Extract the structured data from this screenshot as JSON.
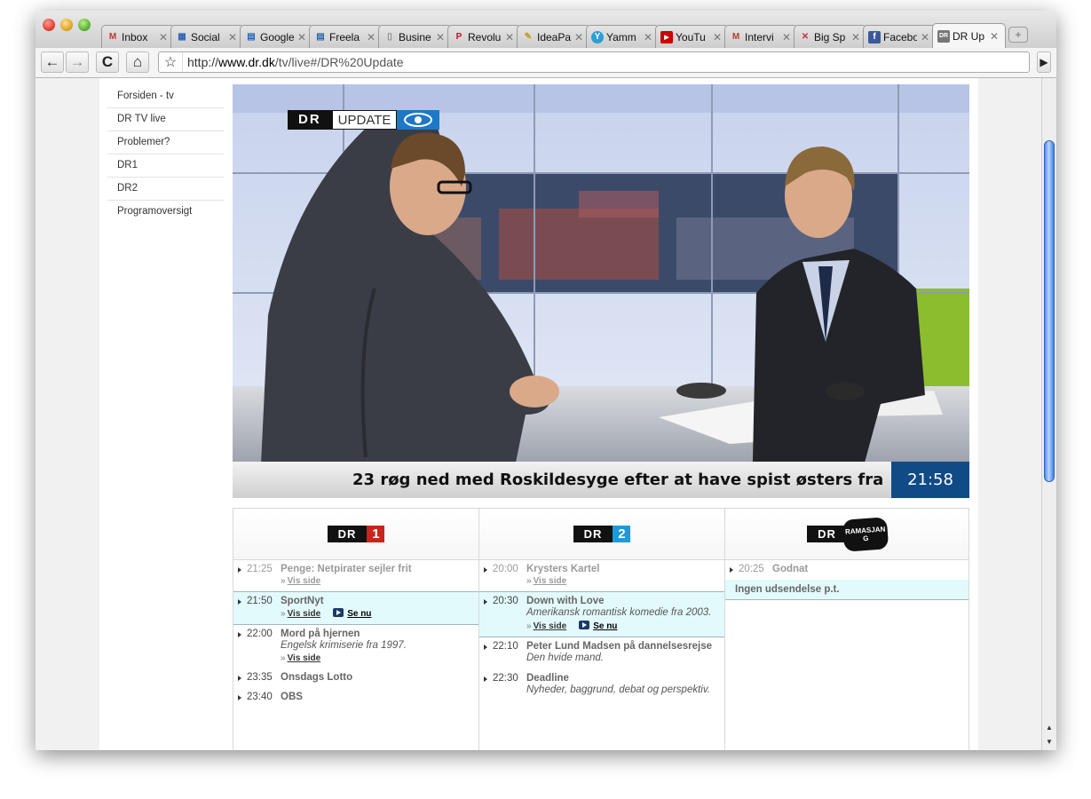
{
  "browser": {
    "tabs": [
      {
        "label": "Inbox",
        "icon": "gmail-icon",
        "glyph": "M",
        "color": "#c0392b"
      },
      {
        "label": "Social",
        "icon": "calendar-icon",
        "glyph": "▦",
        "color": "#2a64b4"
      },
      {
        "label": "Google",
        "icon": "google-docs-icon",
        "glyph": "▤",
        "color": "#2a64b4"
      },
      {
        "label": "Freela",
        "icon": "google-docs-icon",
        "glyph": "▤",
        "color": "#2a64b4"
      },
      {
        "label": "Busine",
        "icon": "page-icon",
        "glyph": "▯",
        "color": "#888888"
      },
      {
        "label": "Revolu",
        "icon": "pinterest-icon",
        "glyph": "P",
        "color": "#c8102e"
      },
      {
        "label": "IdeaPa",
        "icon": "pencil-icon",
        "glyph": "✎",
        "color": "#c89a1a"
      },
      {
        "label": "Yamm",
        "icon": "yammer-icon",
        "glyph": "Y",
        "color": "#2a9fd6"
      },
      {
        "label": "YouTu",
        "icon": "youtube-icon",
        "glyph": "▶",
        "color": "#cc0000"
      },
      {
        "label": "Intervi",
        "icon": "gmail-icon",
        "glyph": "M",
        "color": "#c0392b"
      },
      {
        "label": "Big Sp",
        "icon": "bigspaceship-icon",
        "glyph": "✕",
        "color": "#d42c3c"
      },
      {
        "label": "Facebo",
        "icon": "facebook-icon",
        "glyph": "f",
        "color": "#3b5998"
      },
      {
        "label": "DR Up",
        "icon": "dr-icon",
        "glyph": "DR",
        "color": "#888888",
        "active": true
      }
    ],
    "url_prefix": "http://",
    "url_domain": "www.dr.dk",
    "url_path": "/tv/live#/DR%20Update"
  },
  "nav": {
    "items": [
      "Forsiden - tv",
      "DR TV live",
      "Problemer?",
      "DR1",
      "DR2",
      "Programoversigt"
    ]
  },
  "video": {
    "logo_dr": "DR",
    "logo_update": "UPDATE",
    "ticker": "23 røg ned med Roskildesyge efter at have spist østers fra",
    "clock": "21:58"
  },
  "channels": {
    "dr1": {
      "logo_text": "DR",
      "logo_num": "1",
      "logo_color": "#c8241b",
      "entries": [
        {
          "time": "21:25",
          "title": "Penge: Netpirater sejler frit",
          "link": "Vis side",
          "state": "past"
        },
        {
          "time": "21:50",
          "title": "SportNyt",
          "link": "Vis side",
          "watch": "Se nu",
          "state": "current"
        },
        {
          "time": "22:00",
          "title": "Mord på hjernen",
          "desc": "Engelsk krimiserie fra 1997.",
          "link": "Vis side"
        },
        {
          "time": "23:35",
          "title": "Onsdags Lotto"
        },
        {
          "time": "23:40",
          "title": "OBS"
        }
      ]
    },
    "dr2": {
      "logo_text": "DR",
      "logo_num": "2",
      "logo_color": "#1d9bd8",
      "entries": [
        {
          "time": "20:00",
          "title": "Krysters Kartel",
          "link": "Vis side",
          "state": "past"
        },
        {
          "time": "20:30",
          "title": "Down with Love",
          "desc": "Amerikansk romantisk komedie fra 2003.",
          "link": "Vis side",
          "watch": "Se nu",
          "state": "current"
        },
        {
          "time": "22:10",
          "title": "Peter Lund Madsen på dannelsesrejse",
          "desc": "Den hvide mand."
        },
        {
          "time": "22:30",
          "title": "Deadline",
          "desc": "Nyheder, baggrund, debat og perspektiv."
        }
      ]
    },
    "ramasjang": {
      "logo_text": "DR",
      "logo_word": "RAMASJANG",
      "entries": [
        {
          "time": "20:25",
          "title": "Godnat",
          "state": "past"
        }
      ],
      "notice": "Ingen udsendelse p.t."
    }
  }
}
